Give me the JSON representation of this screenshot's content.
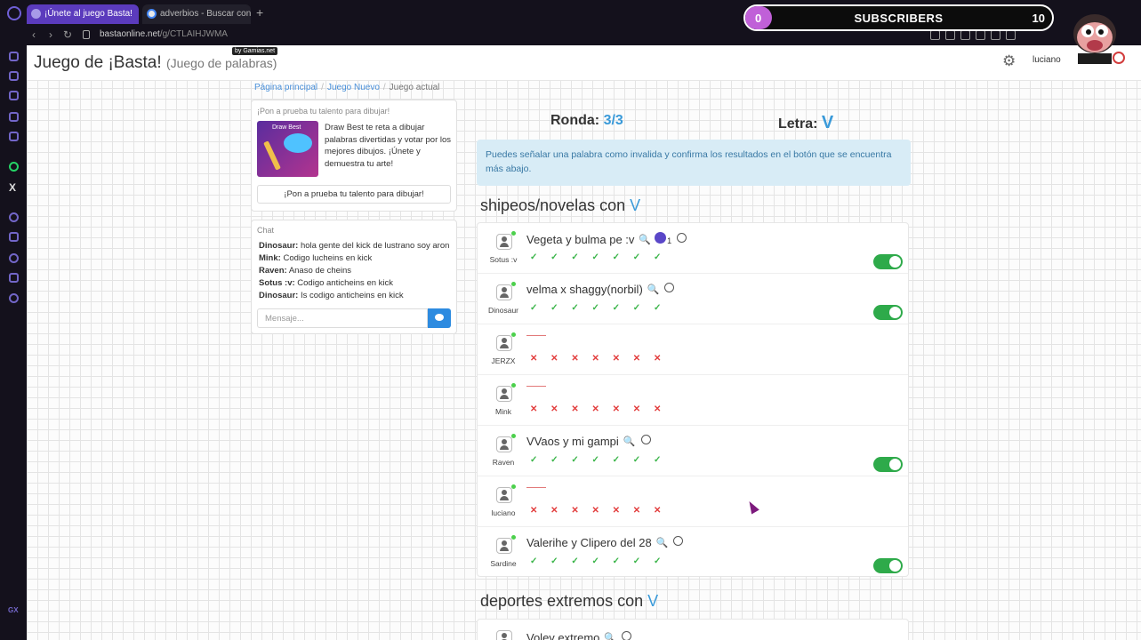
{
  "browser": {
    "tabs": [
      {
        "title": "¡Únete al juego Basta!",
        "active": true
      },
      {
        "title": "adverbios - Buscar con Go",
        "active": false
      }
    ],
    "url_host": "bastaonline.net",
    "url_path": "/g/CTLAIHJWMA"
  },
  "overlay": {
    "current": "0",
    "label": "SUBSCRIBERS",
    "goal": "10",
    "progress": 0
  },
  "header": {
    "title": "Juego de ¡Basta!",
    "subtitle": "(Juego de palabras)",
    "byline": "by Gamias.net",
    "user": "luciano"
  },
  "breadcrumb": {
    "home": "Página principal",
    "new_game": "Juego Nuevo",
    "current": "Juego actual"
  },
  "promo": {
    "title": "¡Pon a prueba tu talento para dibujar!",
    "thumb_title": "Draw Best",
    "description": "Draw Best te reta a dibujar palabras divertidas y votar por los mejores dibujos. ¡Únete y demuestra tu arte!",
    "button": "¡Pon a prueba tu talento para dibujar!"
  },
  "chat": {
    "title": "Chat",
    "messages": [
      {
        "user": "Dinosaur:",
        "text": "hola gente del kick de lustrano soy aron"
      },
      {
        "user": "Mink:",
        "text": "Codigo lucheins en kick"
      },
      {
        "user": "Raven:",
        "text": "Anaso de cheins"
      },
      {
        "user": "Sotus :v:",
        "text": "Codigo anticheins en kick"
      },
      {
        "user": "Dinosaur:",
        "text": "Is codigo anticheins en kick"
      }
    ],
    "placeholder": "Mensaje..."
  },
  "game": {
    "ronda_label": "Ronda:",
    "ronda_value": "3/3",
    "letra_label": "Letra:",
    "letra_value": "V",
    "alert": "Puedes señalar una palabra como invalida y confirma los resultados en el botón que se encuentra más abajo."
  },
  "categories": [
    {
      "name": "shipeos/novelas con",
      "letter": "V",
      "answers": [
        {
          "player": "Sotus :v",
          "answer": "Vegeta y bulma pe :v",
          "votes": "1",
          "valid": true
        },
        {
          "player": "Dinosaur",
          "answer": "velma x shaggy(norbil)",
          "valid": true
        },
        {
          "player": "JERZX",
          "answer": "",
          "valid": false
        },
        {
          "player": "Mink",
          "answer": "",
          "valid": false
        },
        {
          "player": "Raven",
          "answer": "VVaos y mi gampi",
          "valid": true
        },
        {
          "player": "luciano",
          "answer": "",
          "valid": false
        },
        {
          "player": "Sardine",
          "answer": "Valerihe y Clipero del 28",
          "valid": true
        }
      ]
    },
    {
      "name": "deportes extremos con",
      "letter": "V",
      "answers": [
        {
          "player": "",
          "answer": "Voley extremo",
          "valid": true
        }
      ]
    }
  ],
  "marks": {
    "ok": "✓ ✓ ✓ ✓ ✓ ✓ ✓",
    "bad": "✕ ✕ ✕ ✕ ✕ ✕ ✕"
  },
  "icons": {
    "search": "search-icon",
    "smile": "add-reaction-icon",
    "vote": "thumbs-up-icon",
    "settings": "gear-icon",
    "logout": "power-icon"
  },
  "colors": {
    "accent": "#3a9ad9",
    "ok": "#3bb54a",
    "bad": "#e23c3c",
    "toggle_on": "#2eaa4a",
    "tab_active": "#5b3bbd"
  }
}
